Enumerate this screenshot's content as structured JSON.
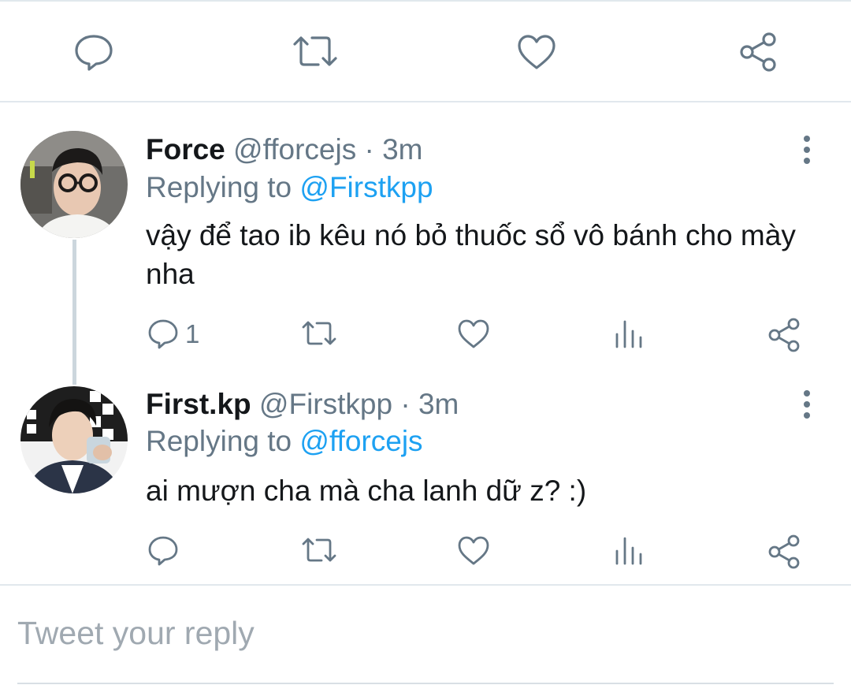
{
  "top_actions": {
    "icons": [
      "reply-icon",
      "retweet-icon",
      "like-icon",
      "share-icon"
    ]
  },
  "tweets": [
    {
      "name": "Force",
      "handle": "@fforcejs",
      "time": "· 3m",
      "replying_prefix": "Replying to",
      "replying_to": "@Firstkpp",
      "text": "vậy để tao ib kêu nó bỏ thuốc sổ vô bánh cho mày nha",
      "reply_count": "1"
    },
    {
      "name": "First.kp",
      "handle": "@Firstkpp",
      "time": "· 3m",
      "replying_prefix": "Replying to",
      "replying_to": "@fforcejs",
      "text": "ai mượn cha mà cha lanh dữ z? :)",
      "reply_count": ""
    }
  ],
  "composer": {
    "placeholder": "Tweet your reply"
  },
  "colors": {
    "accent": "#1da1f2",
    "muted": "#657786",
    "divider": "#e1e8ed"
  }
}
